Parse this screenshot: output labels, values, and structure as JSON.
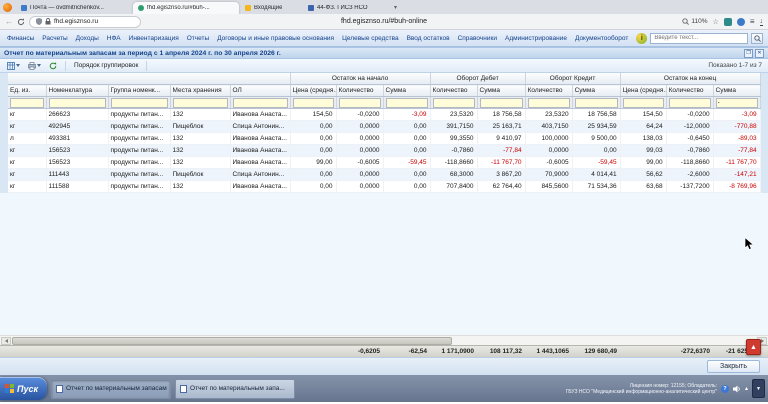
{
  "browser": {
    "tabs": [
      {
        "title": "Почта — ovdmitrichenkov..."
      },
      {
        "title": "fhd.egisznso.ru/#buh-..."
      },
      {
        "title": "Входящие"
      },
      {
        "title": "44-ФЗ. ГИСЗ НСО"
      }
    ],
    "url": "fhd.egisznso.ru",
    "window_title": "fhd.egisznso.ru/#buh-online",
    "zoom": "110%"
  },
  "app_menu": {
    "items": [
      "Финансы",
      "Расчеты",
      "Доходы",
      "НФА",
      "Инвентаризация",
      "Отчеты",
      "Договоры и иные правовые основания",
      "Целевые средства",
      "Ввод остатков",
      "Справочники",
      "Администрирование",
      "Документооборот"
    ],
    "info_icon": "info-owl-badge",
    "search_placeholder": "Введите текст..."
  },
  "report": {
    "title": "Отчет по материальным запасам за период с 1 апреля 2024 г. по 30 апреля 2026 г.",
    "grouping_button": "Порядок группировок",
    "paging": "Показано 1-7 из 7",
    "close_button": "Закрыть"
  },
  "grid": {
    "header_groups": [
      {
        "label": "",
        "span": 5
      },
      {
        "label": "Остаток на начало",
        "span": 3
      },
      {
        "label": "Оборот Дебет",
        "span": 2
      },
      {
        "label": "Оборот Кредит",
        "span": 2
      },
      {
        "label": "Остаток на конец",
        "span": 3
      }
    ],
    "columns": [
      "Ед. из.",
      "Номенклатура",
      "Группа номенк...",
      "Места хранения",
      "ОЛ",
      "Цена (средня...",
      "Количество",
      "Сумма",
      "Количество",
      "Сумма",
      "Количество",
      "Сумма",
      "Цена (средня...",
      "Количество",
      "Сумма"
    ],
    "filter_row": [
      "",
      "",
      "",
      "",
      "",
      "",
      "",
      "",
      "",
      "",
      "",
      "",
      "",
      "",
      "-"
    ],
    "rows": [
      [
        "кг",
        "266623",
        "продукты питан...",
        "132",
        "Иванова Анаста...",
        "154,50",
        "-0,0200",
        "-3,09",
        "23,5320",
        "18 756,58",
        "23,5320",
        "18 756,58",
        "154,50",
        "-0,0200",
        "-3,09"
      ],
      [
        "кг",
        "492945",
        "продукты питан...",
        "Пищеблок",
        "Спица Антонин...",
        "0,00",
        "0,0000",
        "0,00",
        "391,7150",
        "25 163,71",
        "403,7150",
        "25 934,59",
        "64,24",
        "-12,0000",
        "-770,88"
      ],
      [
        "л",
        "493381",
        "продукты питан...",
        "132",
        "Иванова Анаста...",
        "0,00",
        "0,0000",
        "0,00",
        "99,3550",
        "9 410,97",
        "100,0000",
        "9 500,00",
        "138,03",
        "-0,6450",
        "-89,03"
      ],
      [
        "кг",
        "156523",
        "продукты питан...",
        "132",
        "Иванова Анаста...",
        "0,00",
        "0,0000",
        "0,00",
        "-0,7860",
        "-77,84",
        "0,0000",
        "0,00",
        "99,03",
        "-0,7860",
        "-77,84"
      ],
      [
        "кг",
        "156523",
        "продукты питан...",
        "132",
        "Иванова Анаста...",
        "99,00",
        "-0,6005",
        "-59,45",
        "-118,8660",
        "-11 767,70",
        "-0,6005",
        "-59,45",
        "99,00",
        "-118,8660",
        "-11 767,70"
      ],
      [
        "кг",
        "111443",
        "продукты питан...",
        "Пищеблок",
        "Спица Антонин...",
        "0,00",
        "0,0000",
        "0,00",
        "68,3000",
        "3 867,20",
        "70,9000",
        "4 014,41",
        "56,62",
        "-2,6000",
        "-147,21"
      ],
      [
        "кг",
        "111588",
        "продукты питан...",
        "132",
        "Иванова Анаста...",
        "0,00",
        "0,0000",
        "0,00",
        "707,8400",
        "62 764,40",
        "845,5600",
        "71 534,36",
        "63,68",
        "-137,7200",
        "-8 769,96"
      ]
    ],
    "totals": [
      "",
      "",
      "",
      "",
      "",
      "",
      "-0,6205",
      "-62,54",
      "1 171,0900",
      "108 117,32",
      "1 443,1065",
      "129 680,49",
      "",
      "-272,6370",
      "-21 625,71"
    ],
    "sum_columns": [
      7,
      9,
      11,
      14
    ]
  },
  "colors": {
    "accent": "#15428b",
    "negative": "#cc0000",
    "alt_row": "#eef4fb",
    "filter_bg": "#fffcd9"
  },
  "taskbar": {
    "start_label": "Пуск",
    "tasks": [
      "Отчет по материальным запасам",
      "Отчет по материальным запа..."
    ],
    "license_line1": "Лицензия номер: 12155; Обладатель:",
    "license_line2": "ГБУЗ НСО \"Медицинский информационно-аналитический центр\""
  }
}
